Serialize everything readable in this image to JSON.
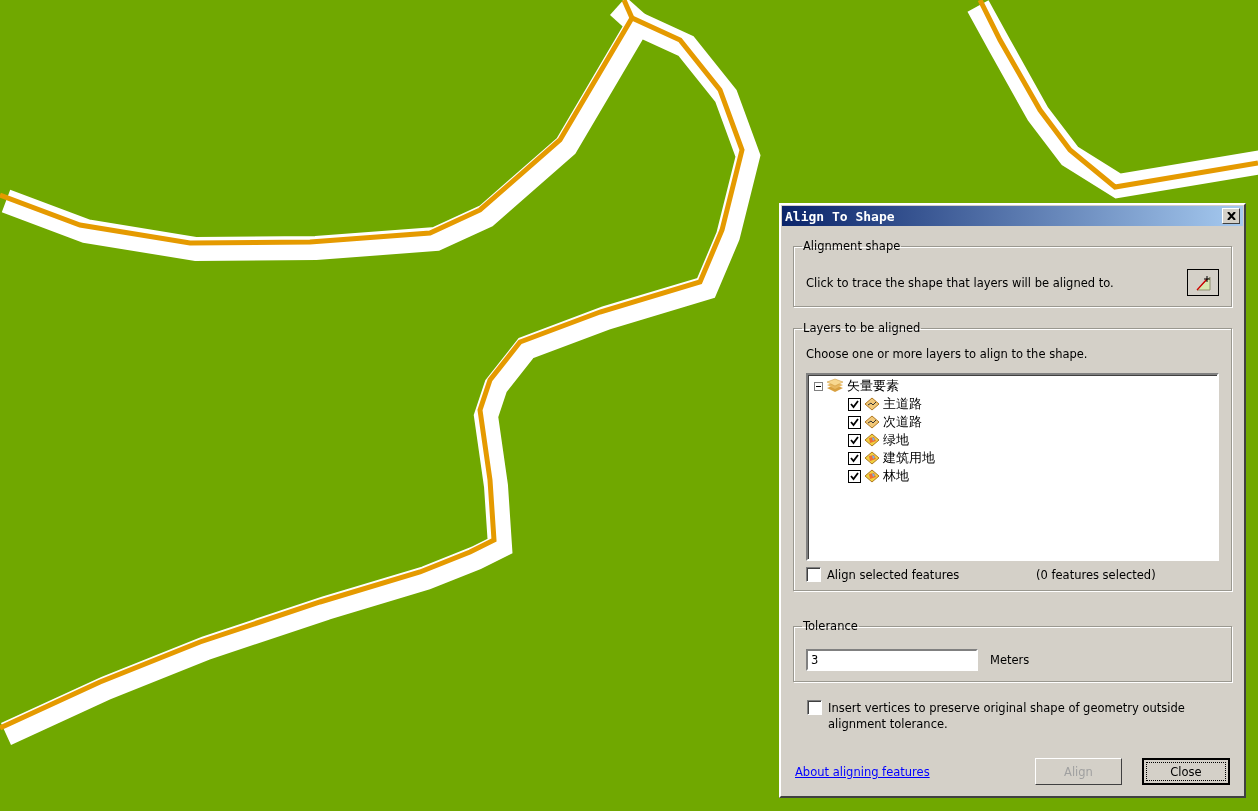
{
  "window": {
    "title": "Align To Shape"
  },
  "alignment_shape": {
    "legend": "Alignment shape",
    "instruction": "Click to trace the shape that layers will be aligned to."
  },
  "layers": {
    "legend": "Layers to be aligned",
    "instruction": "Choose one or more layers to align to the shape.",
    "tree": {
      "label": "矢量要素",
      "expanded": true,
      "children": [
        {
          "label": "主道路",
          "checked": true,
          "kind": "line"
        },
        {
          "label": "次道路",
          "checked": true,
          "kind": "line"
        },
        {
          "label": "绿地",
          "checked": true,
          "kind": "polygon"
        },
        {
          "label": "建筑用地",
          "checked": true,
          "kind": "polygon"
        },
        {
          "label": "林地",
          "checked": true,
          "kind": "polygon"
        }
      ]
    },
    "align_selected": {
      "label": "Align selected features",
      "checked": false
    },
    "selected_count": "(0 features selected)"
  },
  "tolerance": {
    "legend": "Tolerance",
    "value": "3",
    "unit": "Meters"
  },
  "insert_vertices": {
    "label": "Insert vertices to preserve original shape of geometry outside alignment tolerance.",
    "checked": false
  },
  "help_link": "About aligning features",
  "buttons": [
    {
      "label": "Align",
      "disabled": true,
      "default": false
    },
    {
      "label": "Close",
      "disabled": false,
      "default": true
    }
  ]
}
